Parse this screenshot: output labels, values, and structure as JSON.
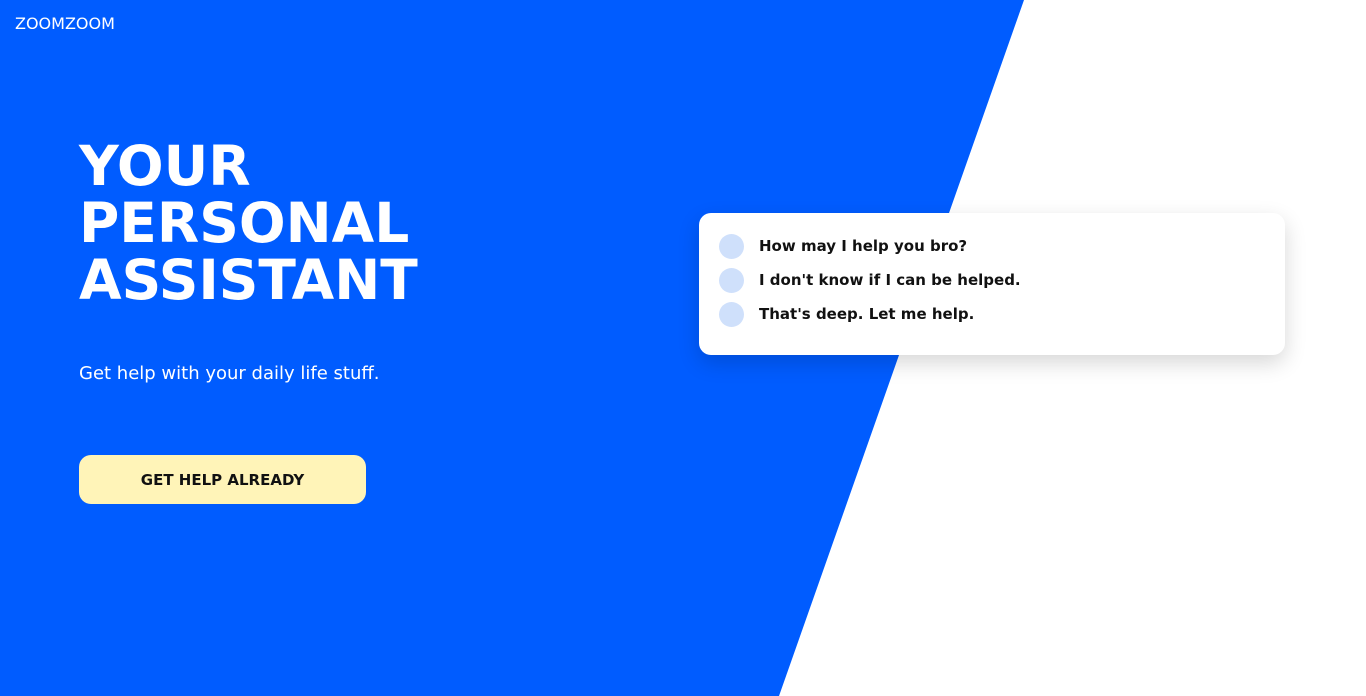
{
  "header": {
    "brand": "ZOOMZOOM"
  },
  "hero": {
    "headline_lines": [
      "YOUR",
      "PERSONAL",
      "ASSISTANT"
    ],
    "tagline": "Get help with your daily life stuff.",
    "cta_label": "GET HELP ALREADY"
  },
  "chat": {
    "messages": [
      {
        "text": "How may I help you bro?",
        "avatar_icon": "avatar-dot-icon"
      },
      {
        "text": "I don't know if I can be helped.",
        "avatar_icon": "avatar-dot-icon"
      },
      {
        "text": "That's deep. Let me help.",
        "avatar_icon": "avatar-dot-icon"
      }
    ]
  },
  "colors": {
    "brand_blue": "#005cff",
    "cta_yellow": "#fff4b8",
    "avatar_light_blue": "#cfe0fb",
    "text_dark": "#111111",
    "background": "#ffffff"
  }
}
